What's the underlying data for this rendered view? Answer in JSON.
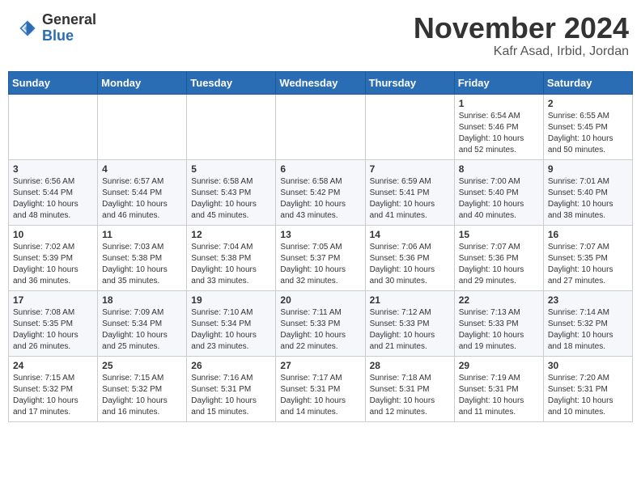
{
  "header": {
    "logo": {
      "line1": "General",
      "line2": "Blue"
    },
    "title": "November 2024",
    "location": "Kafr Asad, Irbid, Jordan"
  },
  "weekdays": [
    "Sunday",
    "Monday",
    "Tuesday",
    "Wednesday",
    "Thursday",
    "Friday",
    "Saturday"
  ],
  "weeks": [
    [
      {
        "day": null,
        "info": null
      },
      {
        "day": null,
        "info": null
      },
      {
        "day": null,
        "info": null
      },
      {
        "day": null,
        "info": null
      },
      {
        "day": null,
        "info": null
      },
      {
        "day": "1",
        "info": "Sunrise: 6:54 AM\nSunset: 5:46 PM\nDaylight: 10 hours\nand 52 minutes."
      },
      {
        "day": "2",
        "info": "Sunrise: 6:55 AM\nSunset: 5:45 PM\nDaylight: 10 hours\nand 50 minutes."
      }
    ],
    [
      {
        "day": "3",
        "info": "Sunrise: 6:56 AM\nSunset: 5:44 PM\nDaylight: 10 hours\nand 48 minutes."
      },
      {
        "day": "4",
        "info": "Sunrise: 6:57 AM\nSunset: 5:44 PM\nDaylight: 10 hours\nand 46 minutes."
      },
      {
        "day": "5",
        "info": "Sunrise: 6:58 AM\nSunset: 5:43 PM\nDaylight: 10 hours\nand 45 minutes."
      },
      {
        "day": "6",
        "info": "Sunrise: 6:58 AM\nSunset: 5:42 PM\nDaylight: 10 hours\nand 43 minutes."
      },
      {
        "day": "7",
        "info": "Sunrise: 6:59 AM\nSunset: 5:41 PM\nDaylight: 10 hours\nand 41 minutes."
      },
      {
        "day": "8",
        "info": "Sunrise: 7:00 AM\nSunset: 5:40 PM\nDaylight: 10 hours\nand 40 minutes."
      },
      {
        "day": "9",
        "info": "Sunrise: 7:01 AM\nSunset: 5:40 PM\nDaylight: 10 hours\nand 38 minutes."
      }
    ],
    [
      {
        "day": "10",
        "info": "Sunrise: 7:02 AM\nSunset: 5:39 PM\nDaylight: 10 hours\nand 36 minutes."
      },
      {
        "day": "11",
        "info": "Sunrise: 7:03 AM\nSunset: 5:38 PM\nDaylight: 10 hours\nand 35 minutes."
      },
      {
        "day": "12",
        "info": "Sunrise: 7:04 AM\nSunset: 5:38 PM\nDaylight: 10 hours\nand 33 minutes."
      },
      {
        "day": "13",
        "info": "Sunrise: 7:05 AM\nSunset: 5:37 PM\nDaylight: 10 hours\nand 32 minutes."
      },
      {
        "day": "14",
        "info": "Sunrise: 7:06 AM\nSunset: 5:36 PM\nDaylight: 10 hours\nand 30 minutes."
      },
      {
        "day": "15",
        "info": "Sunrise: 7:07 AM\nSunset: 5:36 PM\nDaylight: 10 hours\nand 29 minutes."
      },
      {
        "day": "16",
        "info": "Sunrise: 7:07 AM\nSunset: 5:35 PM\nDaylight: 10 hours\nand 27 minutes."
      }
    ],
    [
      {
        "day": "17",
        "info": "Sunrise: 7:08 AM\nSunset: 5:35 PM\nDaylight: 10 hours\nand 26 minutes."
      },
      {
        "day": "18",
        "info": "Sunrise: 7:09 AM\nSunset: 5:34 PM\nDaylight: 10 hours\nand 25 minutes."
      },
      {
        "day": "19",
        "info": "Sunrise: 7:10 AM\nSunset: 5:34 PM\nDaylight: 10 hours\nand 23 minutes."
      },
      {
        "day": "20",
        "info": "Sunrise: 7:11 AM\nSunset: 5:33 PM\nDaylight: 10 hours\nand 22 minutes."
      },
      {
        "day": "21",
        "info": "Sunrise: 7:12 AM\nSunset: 5:33 PM\nDaylight: 10 hours\nand 21 minutes."
      },
      {
        "day": "22",
        "info": "Sunrise: 7:13 AM\nSunset: 5:33 PM\nDaylight: 10 hours\nand 19 minutes."
      },
      {
        "day": "23",
        "info": "Sunrise: 7:14 AM\nSunset: 5:32 PM\nDaylight: 10 hours\nand 18 minutes."
      }
    ],
    [
      {
        "day": "24",
        "info": "Sunrise: 7:15 AM\nSunset: 5:32 PM\nDaylight: 10 hours\nand 17 minutes."
      },
      {
        "day": "25",
        "info": "Sunrise: 7:15 AM\nSunset: 5:32 PM\nDaylight: 10 hours\nand 16 minutes."
      },
      {
        "day": "26",
        "info": "Sunrise: 7:16 AM\nSunset: 5:31 PM\nDaylight: 10 hours\nand 15 minutes."
      },
      {
        "day": "27",
        "info": "Sunrise: 7:17 AM\nSunset: 5:31 PM\nDaylight: 10 hours\nand 14 minutes."
      },
      {
        "day": "28",
        "info": "Sunrise: 7:18 AM\nSunset: 5:31 PM\nDaylight: 10 hours\nand 12 minutes."
      },
      {
        "day": "29",
        "info": "Sunrise: 7:19 AM\nSunset: 5:31 PM\nDaylight: 10 hours\nand 11 minutes."
      },
      {
        "day": "30",
        "info": "Sunrise: 7:20 AM\nSunset: 5:31 PM\nDaylight: 10 hours\nand 10 minutes."
      }
    ]
  ]
}
